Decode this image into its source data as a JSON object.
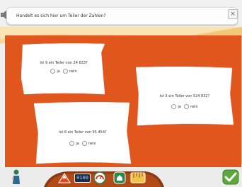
{
  "instruction": {
    "text": "Handelt es sich hier um Teiler der Zahlen?"
  },
  "cards": [
    {
      "question": "Ist 9 ein Teiler von 24 633?",
      "options": [
        "ja",
        "nein"
      ]
    },
    {
      "question": "Ist 3 ein Teiler von 524 832?",
      "options": [
        "ja",
        "nein"
      ]
    },
    {
      "question": "Ist 6 ein Teiler von 95 454?",
      "options": [
        "ja",
        "nein"
      ]
    }
  ],
  "toolbar": {
    "time": "0100"
  },
  "colors": {
    "background_orange": "#e0561c",
    "sand": "#f4d08e",
    "card": "#ffffff",
    "confirm_green": "#5ba93a"
  },
  "icons": [
    "speaker-icon",
    "close-icon",
    "figure-icon",
    "mountain-icon",
    "clock-icon",
    "gauge-icon",
    "home-icon",
    "ruler-icon",
    "check-icon"
  ]
}
